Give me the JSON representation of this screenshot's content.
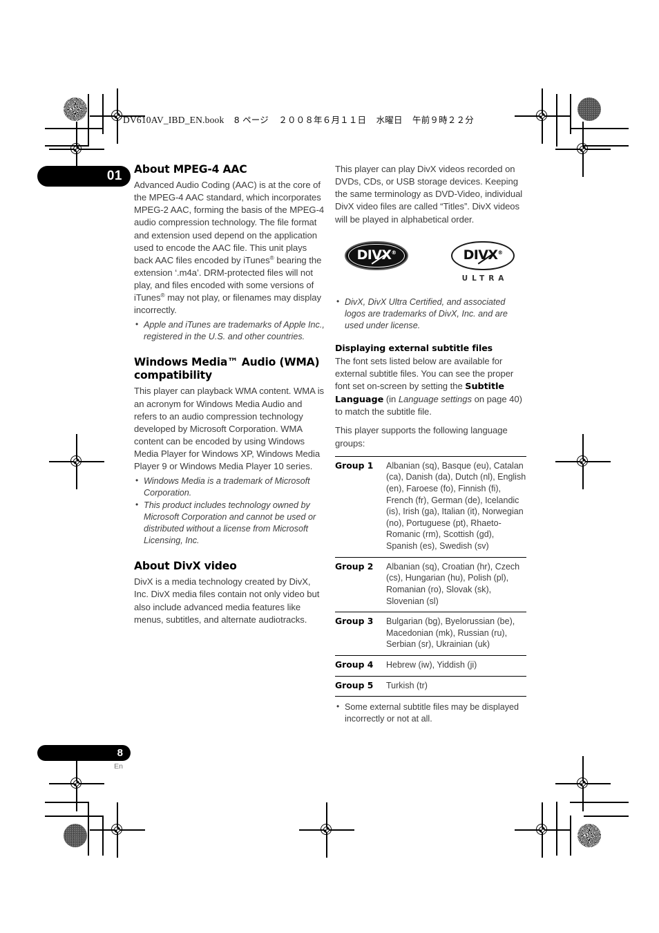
{
  "header": {
    "file_line": "DV610AV_IBD_EN.book",
    "page_marker": "8 ページ",
    "date": "２００８年６月１１日",
    "weekday": "水曜日",
    "time": "午前９時２２分"
  },
  "chapter_tab": "01",
  "left_column": {
    "heading_1": "About MPEG-4 AAC",
    "para_1_part1": "Advanced Audio Coding (AAC) is at the core of the MPEG-4 AAC standard, which incorporates MPEG-2 AAC, forming the basis of the MPEG-4 audio compression technology. The file format and extension used depend on the application used to encode the AAC file. This unit plays back AAC files encoded by iTunes",
    "para_1_part2": " bearing the extension ‘.m4a’. DRM-protected files will not play, and files encoded with some versions of iTunes",
    "para_1_part3": " may not play, or filenames may display incorrectly.",
    "reg_symbol": "®",
    "notes_1": [
      "Apple and iTunes are trademarks of Apple Inc., registered in the U.S. and other countries."
    ],
    "heading_2": "Windows Media™ Audio (WMA) compatibility",
    "para_2": "This player can playback WMA content. WMA is an acronym for Windows Media Audio and refers to an audio compression technology developed by Microsoft Corporation. WMA content can be encoded by using Windows Media Player for Windows XP, Windows Media Player 9 or Windows Media Player 10 series.",
    "notes_2": [
      "Windows Media is a trademark of Microsoft Corporation.",
      "This product includes technology owned by Microsoft Corporation and cannot be used or distributed without a license from Microsoft Licensing, Inc."
    ],
    "heading_3": "About DivX video",
    "para_3": "DivX is a media technology created by DivX, Inc. DivX media files contain not only video but also include advanced media features like menus, subtitles, and alternate audiotracks."
  },
  "right_column": {
    "para_1": "This player can play DivX videos recorded on DVDs, CDs, or USB storage devices. Keeping the same terminology as DVD-Video, individual DivX video files are called “Titles”. DivX videos will be played in alphabetical order.",
    "logos": [
      {
        "wordmark": "DIVX",
        "registered": "®",
        "style": "filled",
        "sublabel": ""
      },
      {
        "wordmark": "DIVX",
        "registered": "®",
        "style": "outline",
        "sublabel": "ULTRA"
      }
    ],
    "notes_1": [
      "DivX, DivX Ultra Certified, and associated logos are trademarks of DivX, Inc. and are used under license."
    ],
    "subheading_1": "Displaying external subtitle files",
    "para_2_part1": "The font sets listed below are available for external subtitle files. You can see the proper font set on-screen by setting the ",
    "para_2_bold1": "Subtitle Language",
    "para_2_part2": " (in ",
    "para_2_italic1": "Language settings",
    "para_2_part3": " on page 40) to match the subtitle file.",
    "para_3": "This player supports the following language groups:",
    "language_table": {
      "rows": [
        {
          "group": "Group 1",
          "languages": "Albanian (sq), Basque (eu), Catalan (ca), Danish (da), Dutch (nl), English (en), Faroese (fo), Finnish (fi), French (fr), German (de), Icelandic (is), Irish (ga), Italian (it), Norwegian (no), Portuguese (pt), Rhaeto-Romanic (rm), Scottish (gd), Spanish (es), Swedish (sv)"
        },
        {
          "group": "Group 2",
          "languages": "Albanian (sq), Croatian (hr), Czech (cs), Hungarian (hu), Polish (pl), Romanian (ro), Slovak (sk), Slovenian (sl)"
        },
        {
          "group": "Group 3",
          "languages": "Bulgarian (bg), Byelorussian (be), Macedonian (mk), Russian (ru), Serbian (sr), Ukrainian (uk)"
        },
        {
          "group": "Group 4",
          "languages": "Hebrew (iw), Yiddish (ji)"
        },
        {
          "group": "Group 5",
          "languages": "Turkish (tr)"
        }
      ]
    },
    "notes_2": [
      "Some external subtitle files may be displayed incorrectly or not at all."
    ]
  },
  "footer": {
    "page_number": "8",
    "language_code": "En"
  }
}
